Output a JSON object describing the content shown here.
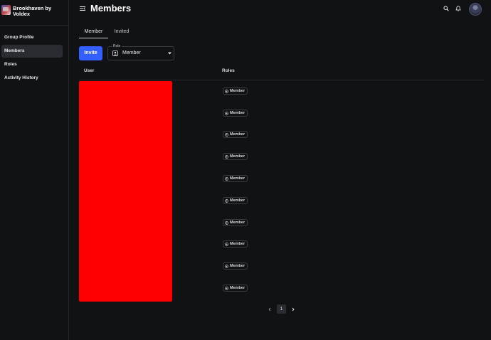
{
  "sidebar": {
    "group_name": "Brookhaven by Voldex",
    "items": [
      {
        "label": "Group Profile",
        "active": false
      },
      {
        "label": "Members",
        "active": true
      },
      {
        "label": "Roles",
        "active": false
      },
      {
        "label": "Activity History",
        "active": false
      }
    ]
  },
  "header": {
    "title": "Members",
    "icons": [
      "search-icon",
      "notification-bell-icon",
      "avatar"
    ]
  },
  "tabs": [
    {
      "label": "Member",
      "active": true
    },
    {
      "label": "Invited",
      "active": false
    }
  ],
  "toolbar": {
    "invite_label": "Invite",
    "role_filter": {
      "legend": "Role",
      "value": "Member"
    }
  },
  "table": {
    "columns": [
      "User",
      "Roles"
    ],
    "rows": [
      {
        "role": "Member"
      },
      {
        "role": "Member"
      },
      {
        "role": "Member"
      },
      {
        "role": "Member"
      },
      {
        "role": "Member"
      },
      {
        "role": "Member"
      },
      {
        "role": "Member"
      },
      {
        "role": "Member"
      },
      {
        "role": "Member"
      },
      {
        "role": "Member"
      }
    ]
  },
  "pagination": {
    "current_page": "1"
  },
  "colors": {
    "background": "#111214",
    "accent": "#335fff",
    "redaction": "#ff0000",
    "border": "#26272b"
  }
}
